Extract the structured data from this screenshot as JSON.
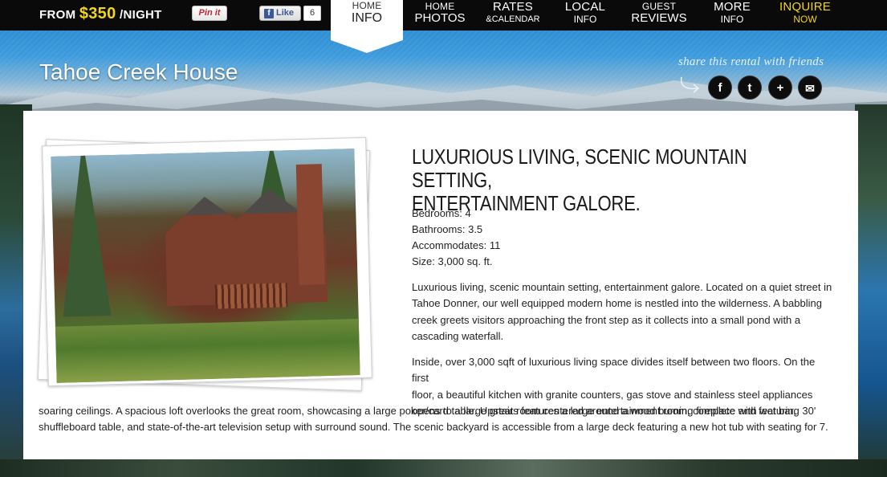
{
  "topbar": {
    "price_prefix": "FROM ",
    "price_amount": "$350",
    "price_suffix": " /NIGHT",
    "pinit_label": "Pin it",
    "fb_like_label": "Like",
    "fb_like_count": "6"
  },
  "nav": {
    "home": {
      "line1": "HOME",
      "line2": "INFO"
    },
    "photos": {
      "line1": "HOME",
      "line2": "PHOTOS"
    },
    "rates": {
      "line1": "RATES",
      "line2": "&CALENDAR"
    },
    "local": {
      "line1": "LOCAL",
      "line2": "INFO"
    },
    "reviews": {
      "line1": "GUEST",
      "line2": "REVIEWS"
    },
    "more": {
      "line1": "MORE",
      "line2": "INFO"
    },
    "inquire": {
      "line1": "INQUIRE",
      "line2": "NOW"
    }
  },
  "header": {
    "site_title": "Tahoe Creek House",
    "share_text": "share this rental with friends",
    "social": [
      {
        "icon": "facebook-icon",
        "glyph": "f"
      },
      {
        "icon": "twitter-icon",
        "glyph": "t"
      },
      {
        "icon": "plus-share-icon",
        "glyph": "+"
      },
      {
        "icon": "email-icon",
        "glyph": "✉"
      }
    ]
  },
  "content": {
    "headline_line1": "LUXURIOUS LIVING, SCENIC MOUNTAIN SETTING,",
    "headline_line2": "ENTERTAINMENT GALORE.",
    "specs": [
      "Bedrooms: 4",
      "Bathrooms: 3.5",
      "Accommodates: 11",
      "Size: 3,000 sq. ft."
    ],
    "para1_lines": [
      "Luxurious living, scenic mountain setting, entertainment galore. Located on a quiet street in",
      "Tahoe Donner, our well equipped modern home is nestled into the wilderness. A babbling",
      "creek greets visitors approaching the front step as it collects into a small pond with a",
      "cascading waterfall."
    ],
    "para2_top_lines": [
      "Inside, over 3,000 sqft of luxurious living space divides itself between two floors. On the first",
      "floor, a beautiful kitchen with granite counters, gas stove and stainless steel appliances",
      "opens to a large great room centered around a wood burning fireplace and featuring 30'"
    ],
    "para2_bottom_lines": [
      "soaring ceilings. A spacious loft overlooks the great room, showcasing a large poker/card table. Upstairs features a large entertainment room, complete with wet bar,",
      "shuffleboard table, and state-of-the-art television setup with surround sound. The scenic backyard is accessible from a large deck featuring a new hot tub with seating for 7."
    ]
  }
}
